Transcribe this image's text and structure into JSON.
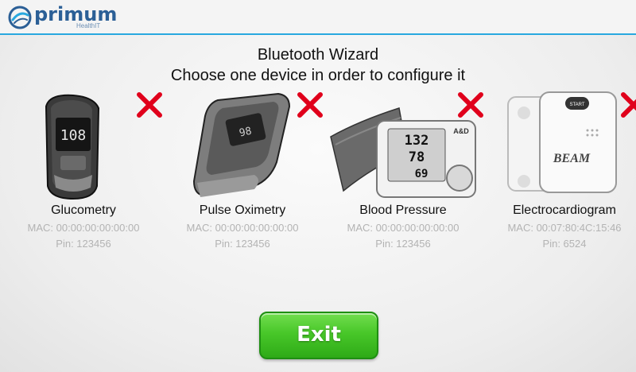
{
  "header": {
    "logo_text": "primum",
    "logo_subtitle": "HealthIT",
    "accent_color": "#29a8df"
  },
  "wizard": {
    "title": "Bluetooth Wizard",
    "subtitle": "Choose one device in order to configure it"
  },
  "devices": [
    {
      "name": "Glucometry",
      "mac": "MAC: 00:00:00:00:00:00",
      "pin": "Pin: 123456",
      "icon": "glucometer-icon",
      "status_icon": "red-x-icon"
    },
    {
      "name": "Pulse Oximetry",
      "mac": "MAC: 00:00:00:00:00:00",
      "pin": "Pin: 123456",
      "icon": "pulse-oximeter-icon",
      "status_icon": "red-x-icon"
    },
    {
      "name": "Blood Pressure",
      "mac": "MAC: 00:00:00:00:00:00",
      "pin": "Pin: 123456",
      "icon": "blood-pressure-monitor-icon",
      "status_icon": "red-x-icon"
    },
    {
      "name": "Electrocardiogram",
      "mac": "MAC: 00:07:80:4C:15:46",
      "pin": "Pin: 6524",
      "icon": "ecg-device-icon",
      "status_icon": "red-x-icon"
    }
  ],
  "device_screens": {
    "glucometer_reading": "108",
    "bp_systolic": "132",
    "bp_diastolic": "78",
    "bp_pulse": "69",
    "bp_brand": "A&D",
    "ecg_brand": "BEAM"
  },
  "actions": {
    "exit_label": "Exit",
    "exit_color": "#48c729"
  },
  "colors": {
    "remove_x": "#e0001b"
  }
}
